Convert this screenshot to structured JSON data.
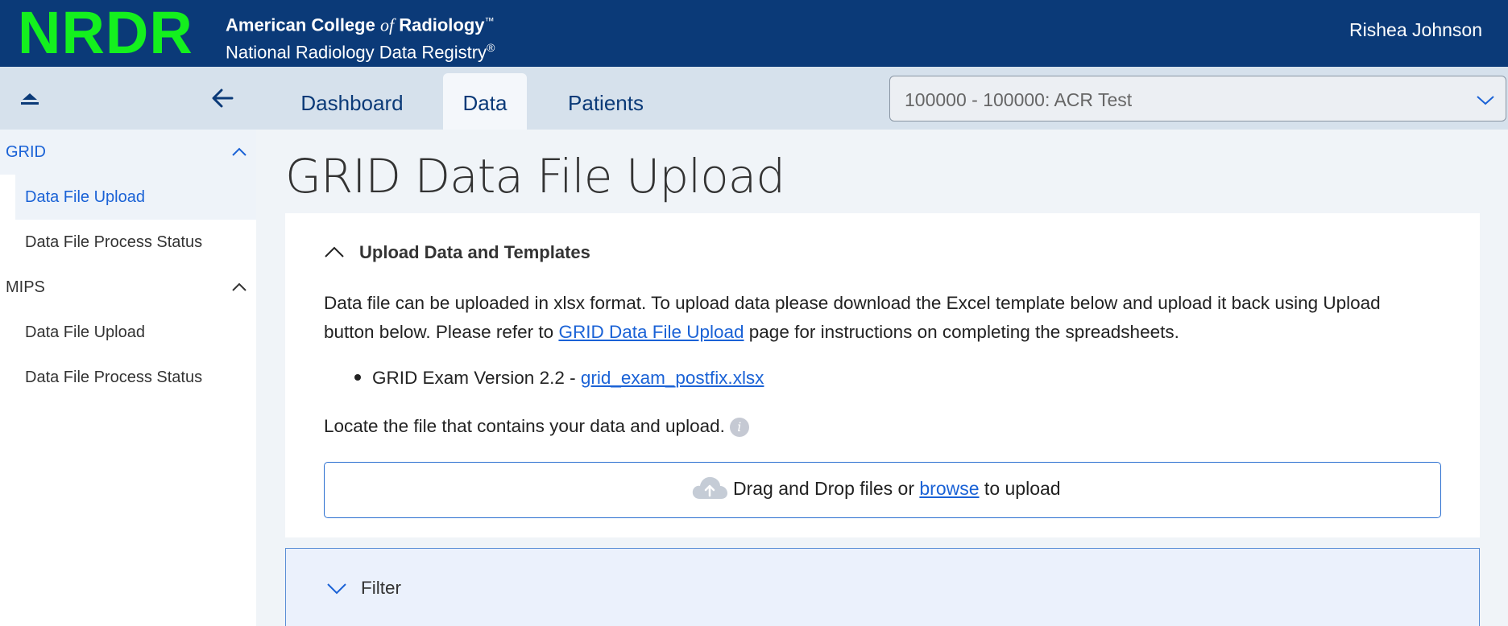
{
  "header": {
    "logo": "NRDR",
    "org_line1_prefix": "American College ",
    "org_line1_of": "of",
    "org_line1_suffix": " Radiology",
    "org_line1_mark": "™",
    "org_line2": "National Radiology Data Registry",
    "org_line2_mark": "®",
    "user_name": "Rishea Johnson",
    "colors": {
      "bar": "#0b3a78",
      "logo": "#14f01e"
    }
  },
  "sidebar": {
    "collapse_icon": "collapse-up-icon",
    "back_icon": "arrow-left-icon",
    "sections": [
      {
        "label": "GRID",
        "expanded": true,
        "items": [
          {
            "label": "Data File Upload",
            "active": true
          },
          {
            "label": "Data File Process Status",
            "active": false
          }
        ]
      },
      {
        "label": "MIPS",
        "expanded": true,
        "items": [
          {
            "label": "Data File Upload",
            "active": false
          },
          {
            "label": "Data File Process Status",
            "active": false
          }
        ]
      }
    ]
  },
  "tabs": [
    {
      "label": "Dashboard",
      "active": false
    },
    {
      "label": "Data",
      "active": true
    },
    {
      "label": "Patients",
      "active": false
    }
  ],
  "facility_select": {
    "value": "100000 - 100000: ACR Test"
  },
  "page_title": "GRID Data File Upload",
  "upload_panel": {
    "heading": "Upload Data and Templates",
    "expanded": true,
    "desc_part1": "Data file can be uploaded in xlsx format. To upload data please download the Excel template below and upload it back using Upload button below. Please refer to ",
    "desc_link": "GRID Data File Upload",
    "desc_part2": " page for instructions on completing the spreadsheets.",
    "template_label": "GRID Exam Version 2.2 - ",
    "template_link": "grid_exam_postfix.xlsx",
    "locate_text": "Locate the file that contains your data and upload.",
    "info_glyph": "i",
    "dropzone_prefix": "Drag and Drop files or ",
    "dropzone_link": "browse",
    "dropzone_suffix": " to upload"
  },
  "filter_panel": {
    "heading": "Filter",
    "expanded": false
  }
}
